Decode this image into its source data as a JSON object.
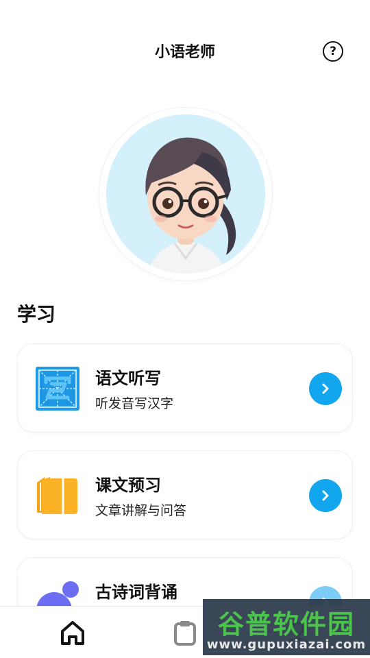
{
  "header": {
    "title": "小语老师",
    "help_symbol": "?"
  },
  "avatar": {
    "icon": "teacher-avatar"
  },
  "section": {
    "title": "学习"
  },
  "cards": [
    {
      "title": "语文听写",
      "subtitle": "听发音写汉字",
      "icon": "dictation-icon"
    },
    {
      "title": "课文预习",
      "subtitle": "文章讲解与问答",
      "icon": "book-icon"
    },
    {
      "title": "古诗词背诵",
      "subtitle": "",
      "icon": "poetry-icon"
    }
  ],
  "bottom_nav": {
    "items": [
      {
        "icon": "home-icon",
        "active": true
      },
      {
        "icon": "clipboard-icon",
        "active": false
      },
      {
        "icon": "profile-icon",
        "active": false
      }
    ]
  },
  "watermark": {
    "main": "谷普软件园",
    "url": "www.gupuxiazai.com"
  },
  "colors": {
    "accent": "#12a6ee",
    "card_icon_orange": "#fbb226",
    "card_icon_purple": "#6b6ef0",
    "avatar_bg": "#d4f0fb"
  }
}
